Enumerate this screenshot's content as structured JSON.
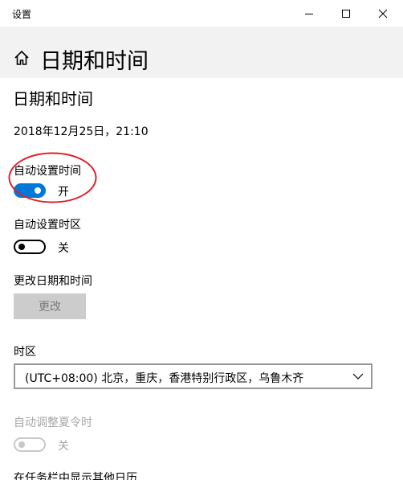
{
  "window": {
    "title": "设置"
  },
  "header": {
    "title": "日期和时间"
  },
  "content": {
    "section_title": "日期和时间",
    "current_datetime": "2018年12月25日，21:10",
    "auto_time": {
      "label": "自动设置时间",
      "state": "开",
      "on": true
    },
    "auto_timezone": {
      "label": "自动设置时区",
      "state": "关",
      "on": false
    },
    "change_datetime": {
      "label": "更改日期和时间",
      "button_label": "更改"
    },
    "timezone": {
      "label": "时区",
      "selected": "(UTC+08:00) 北京，重庆，香港特别行政区，乌鲁木齐"
    },
    "dst": {
      "label": "自动调整夏令时",
      "state": "关",
      "on": false,
      "disabled": true
    },
    "extra_calendar": {
      "label": "在任务栏中显示其他日历"
    }
  },
  "colors": {
    "accent": "#0078d7",
    "header_bg": "#f2f2f2",
    "annotation": "#e0202a",
    "disabled_text": "#a6a6a6"
  },
  "icons": {
    "home": "home-icon",
    "minimize": "minimize-icon",
    "maximize": "maximize-icon",
    "close": "close-icon",
    "dropdown": "chevron-down-icon"
  }
}
